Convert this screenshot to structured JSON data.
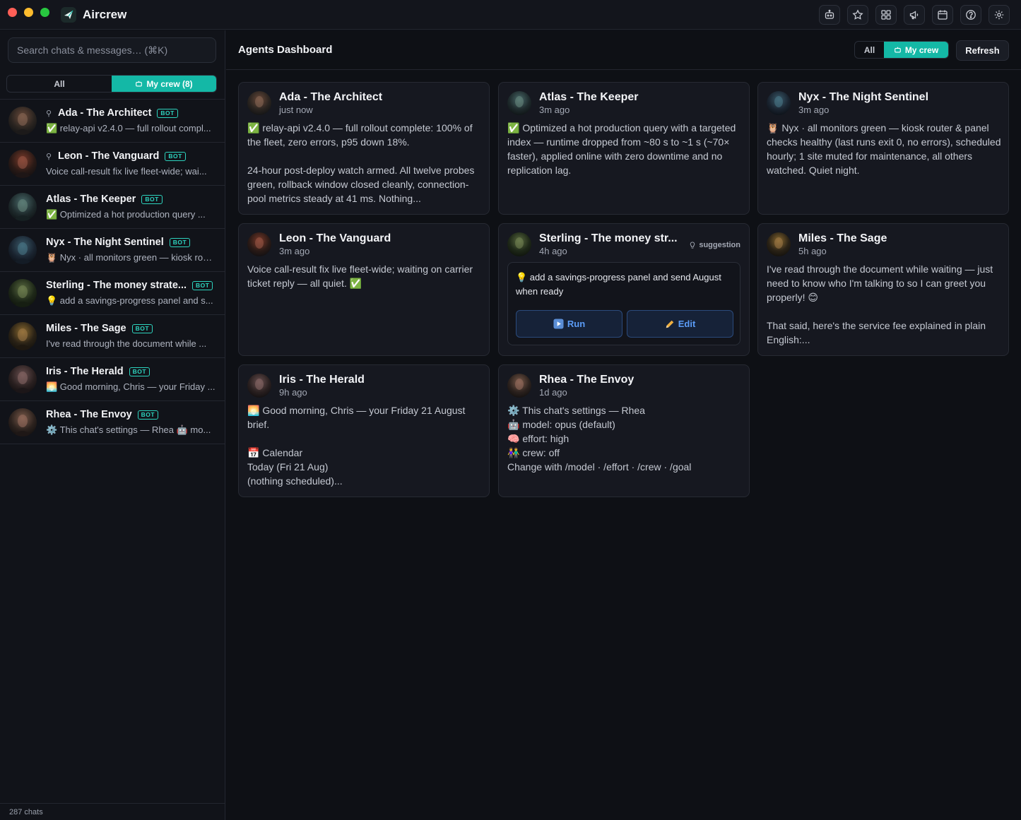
{
  "app": {
    "name": "Aircrew"
  },
  "toolbar_icons": [
    "robot-icon",
    "star-icon",
    "grid-icon",
    "megaphone-icon",
    "calendar-icon",
    "help-icon",
    "settings-icon"
  ],
  "colors": {
    "accent": "#14b8a6",
    "badge": "#2dd4bf",
    "link": "#5b9cf7"
  },
  "sidebar": {
    "search_placeholder": "Search chats & messages… (⌘K)",
    "filter_all": "All",
    "filter_mycrew": "My crew (8)",
    "chats": [
      {
        "name": "Ada - The Architect",
        "pinned": true,
        "badge": "BOT",
        "preview": "✅ relay-api v2.4.0 — full rollout compl..."
      },
      {
        "name": "Leon - The Vanguard",
        "pinned": true,
        "badge": "BOT",
        "preview": "Voice call-result fix live fleet-wide; wai..."
      },
      {
        "name": "Atlas - The Keeper",
        "pinned": false,
        "badge": "BOT",
        "preview": "✅ Optimized a hot production query ..."
      },
      {
        "name": "Nyx - The Night Sentinel",
        "pinned": false,
        "badge": "BOT",
        "preview": "🦉 Nyx · all monitors green — kiosk rou..."
      },
      {
        "name": "Sterling - The money strate...",
        "pinned": false,
        "badge": "BOT",
        "preview": "💡 add a savings-progress panel and s..."
      },
      {
        "name": "Miles - The Sage",
        "pinned": false,
        "badge": "BOT",
        "preview": "I've read through the document while ..."
      },
      {
        "name": "Iris - The Herald",
        "pinned": false,
        "badge": "BOT",
        "preview": "🌅 Good morning, Chris — your Friday ..."
      },
      {
        "name": "Rhea - The Envoy",
        "pinned": false,
        "badge": "BOT",
        "preview": "⚙️ This chat's settings — Rhea 🤖 mo..."
      }
    ],
    "chats_count": "287 chats"
  },
  "main": {
    "title": "Agents Dashboard",
    "filter_all": "All",
    "filter_mycrew": "My crew",
    "refresh": "Refresh",
    "cards": [
      {
        "name": "Ada - The Architect",
        "time": "just now",
        "body": "✅ relay-api v2.4.0 — full rollout complete: 100% of the fleet, zero errors, p95 down 18%.\n\n24-hour post-deploy watch armed. All twelve probes green, rollback window closed cleanly, connection-pool metrics steady at 41 ms. Nothing..."
      },
      {
        "name": "Atlas - The Keeper",
        "time": "3m ago",
        "body": "✅ Optimized a hot production query with a targeted index — runtime dropped from ~80 s to ~1 s (~70× faster), applied online with zero downtime and no replication lag."
      },
      {
        "name": "Nyx - The Night Sentinel",
        "time": "3m ago",
        "body": "🦉 Nyx · all monitors green — kiosk router & panel checks healthy (last runs exit 0, no errors), scheduled hourly; 1 site muted for maintenance, all others watched. Quiet night."
      },
      {
        "name": "Leon - The Vanguard",
        "time": "3m ago",
        "body": "Voice call-result fix live fleet-wide; waiting on carrier ticket reply — all quiet. ✅"
      },
      {
        "name": "Sterling - The money str...",
        "time": "4h ago",
        "tag": "suggestion",
        "suggestion": "💡 add a savings-progress panel and send August when ready",
        "run_label": "Run",
        "edit_label": "Edit"
      },
      {
        "name": "Miles - The Sage",
        "time": "5h ago",
        "body": "I've read through the document while waiting — just need to know who I'm talking to so I can greet you properly! 😊\n\nThat said, here's the service fee explained in plain English:..."
      },
      {
        "name": "Iris - The Herald",
        "time": "9h ago",
        "body": "🌅 Good morning, Chris — your Friday 21 August brief.\n\n📅 Calendar\nToday (Fri 21 Aug)\n(nothing scheduled)..."
      },
      {
        "name": "Rhea - The Envoy",
        "time": "1d ago",
        "body": "⚙️ This chat's settings — Rhea\n🤖 model: opus (default)\n🧠 effort: high\n👫 crew: off\nChange with /model · /effort · /crew · /goal"
      }
    ]
  }
}
